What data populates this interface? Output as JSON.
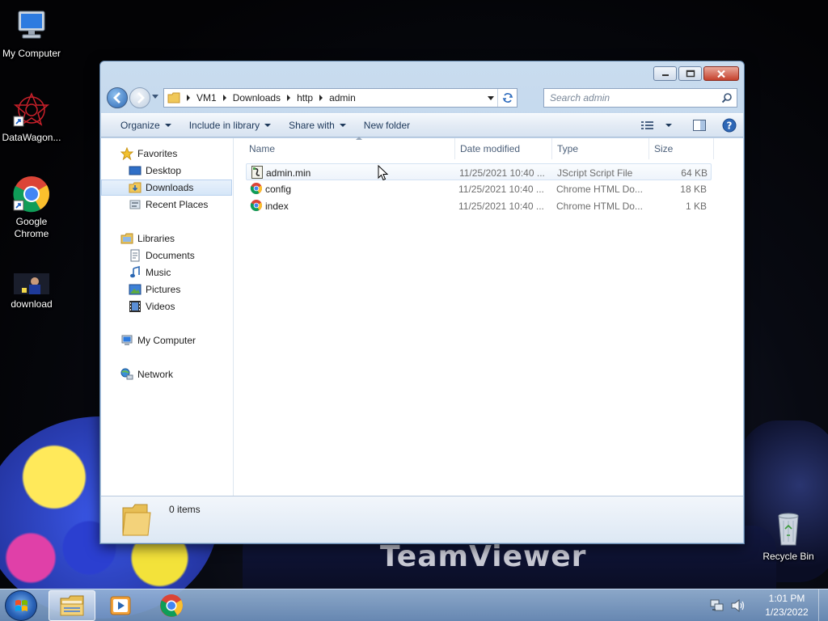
{
  "desktop": {
    "icons": [
      {
        "label": "My Computer",
        "icon": "computer-icon"
      },
      {
        "label": "DataWagon...",
        "icon": "datawagon-shortcut-icon"
      },
      {
        "label": "Google Chrome",
        "icon": "chrome-shortcut-icon"
      },
      {
        "label": "download",
        "icon": "image-file-icon"
      },
      {
        "label": "Recycle Bin",
        "icon": "recycle-bin-icon"
      }
    ],
    "wallpaper_text": "TeamViewer"
  },
  "window": {
    "address": {
      "parts": [
        "VM1",
        "Downloads",
        "http",
        "admin"
      ]
    },
    "search": {
      "placeholder": "Search admin"
    },
    "toolbar": {
      "organize": "Organize",
      "include_in_library": "Include in library",
      "share_with": "Share with",
      "new_folder": "New folder"
    },
    "nav": {
      "favorites": "Favorites",
      "desktop": "Desktop",
      "downloads": "Downloads",
      "recent_places": "Recent Places",
      "libraries": "Libraries",
      "documents": "Documents",
      "music": "Music",
      "pictures": "Pictures",
      "videos": "Videos",
      "my_computer": "My Computer",
      "network": "Network",
      "selected": "Downloads"
    },
    "columns": {
      "name": "Name",
      "date_modified": "Date modified",
      "type": "Type",
      "size": "Size"
    },
    "files": [
      {
        "name": "admin.min",
        "date": "11/25/2021 10:40 ...",
        "type": "JScript Script File",
        "size": "64 KB",
        "icon": "jscript-file-icon"
      },
      {
        "name": "config",
        "date": "11/25/2021 10:40 ...",
        "type": "Chrome HTML Do...",
        "size": "18 KB",
        "icon": "chrome-html-file-icon"
      },
      {
        "name": "index",
        "date": "11/25/2021 10:40 ...",
        "type": "Chrome HTML Do...",
        "size": "1 KB",
        "icon": "chrome-html-file-icon"
      }
    ],
    "details": {
      "item_count": "0 items"
    }
  },
  "taskbar": {
    "apps": [
      "windows-explorer-icon",
      "media-player-icon",
      "chrome-icon"
    ],
    "clock": {
      "time": "1:01 PM",
      "date": "1/23/2022"
    }
  },
  "colors": {
    "window_frame": "#b7cde6",
    "selection": "#d5e6f8",
    "taskbar": "#8aa9cf",
    "close_button": "#c5412d"
  }
}
